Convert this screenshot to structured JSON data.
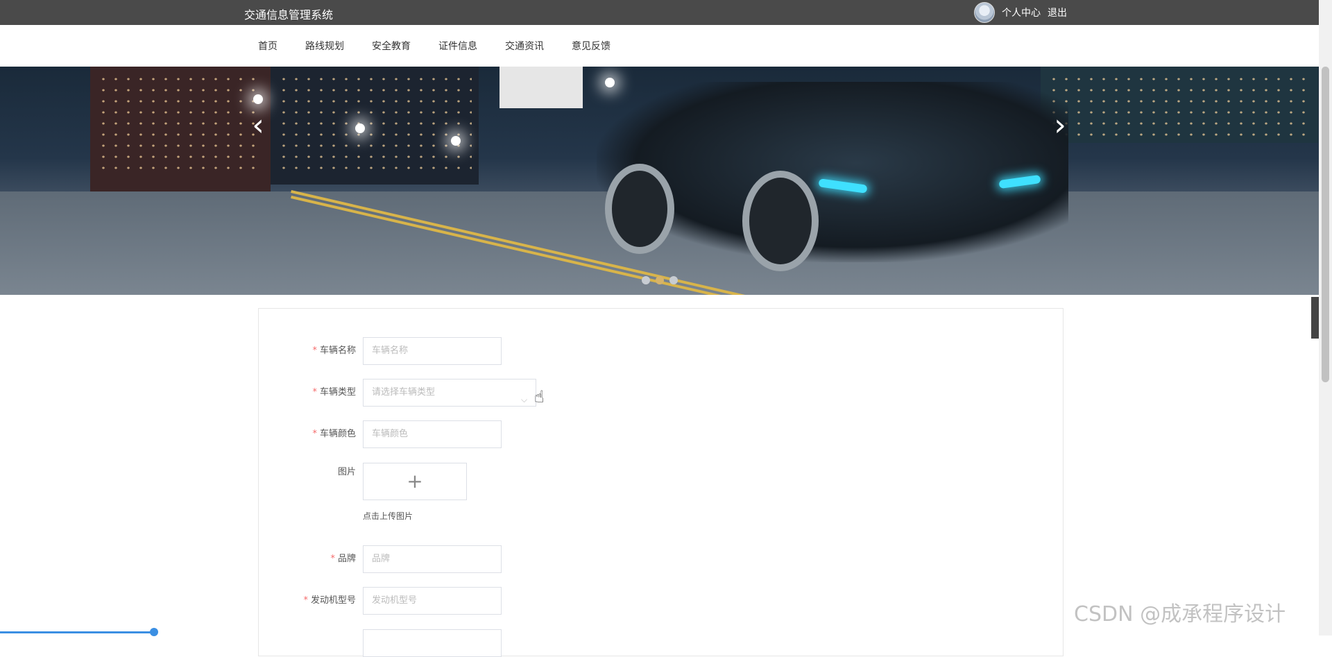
{
  "header": {
    "site_title": "交通信息管理系统",
    "user_center": "个人中心",
    "logout": "退出"
  },
  "nav": {
    "items": [
      "首页",
      "路线规划",
      "安全教育",
      "证件信息",
      "交通资讯",
      "意见反馈"
    ]
  },
  "banner": {
    "prev": "‹",
    "next": "›",
    "slides": 3,
    "active_slide": 2
  },
  "form": {
    "vehicle_name": {
      "label": "车辆名称",
      "placeholder": "车辆名称"
    },
    "vehicle_type": {
      "label": "车辆类型",
      "placeholder": "请选择车辆类型"
    },
    "vehicle_color": {
      "label": "车辆颜色",
      "placeholder": "车辆颜色"
    },
    "image": {
      "label": "图片",
      "plus": "+",
      "hint": "点击上传图片"
    },
    "brand": {
      "label": "品牌",
      "placeholder": "品牌"
    },
    "engine_model": {
      "label": "发动机型号",
      "placeholder": "发动机型号"
    },
    "required_mark": "*"
  },
  "side_tab": "‹",
  "watermark": "CSDN @成承程序设计"
}
